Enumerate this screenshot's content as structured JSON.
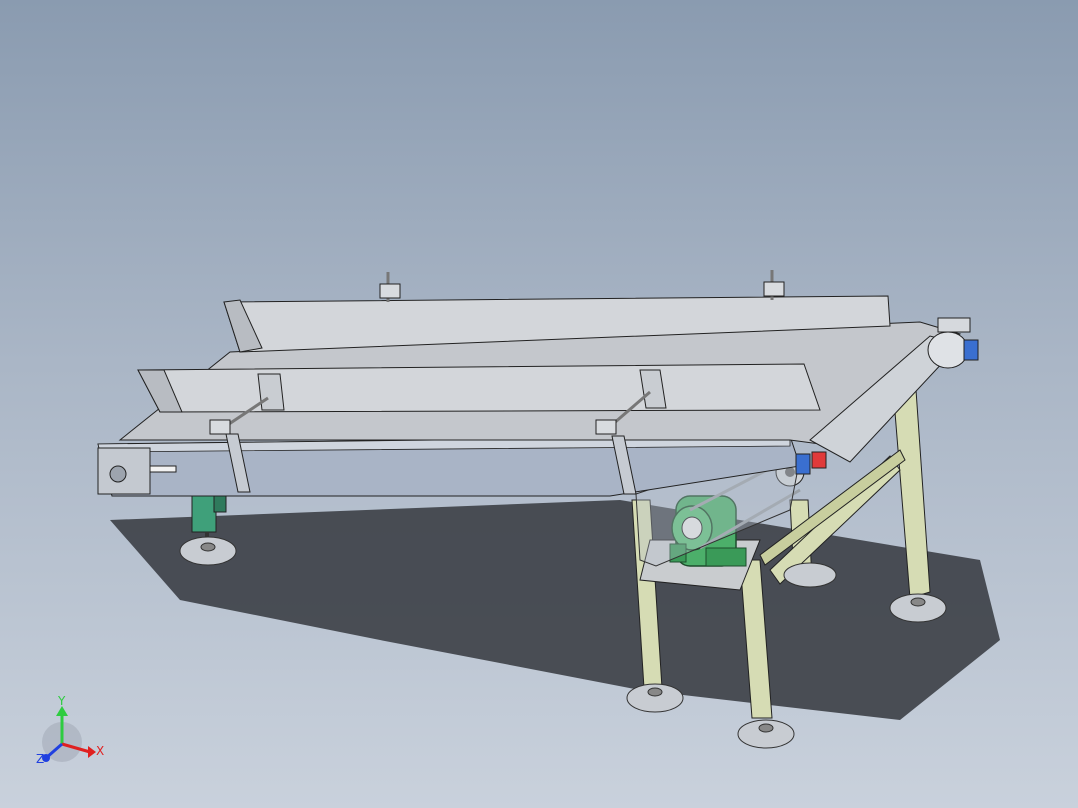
{
  "viewport": {
    "background_top": "#8a9bb0",
    "background_bottom": "#c9d1dc"
  },
  "model": {
    "frame_color": "#d6dcb4",
    "foot_color": "#c8ccd2",
    "motor_color": "#4caf6a",
    "belt_color": "#c4c7cc",
    "guide_color": "#d3d6da",
    "accent_red": "#e03a3a",
    "accent_blue": "#3a6fd0"
  },
  "triad": {
    "y_label": "Y",
    "x_label": "X",
    "z_label": "Z",
    "y_color": "#2ecc40",
    "x_color": "#e02020",
    "z_color": "#2040e0"
  }
}
